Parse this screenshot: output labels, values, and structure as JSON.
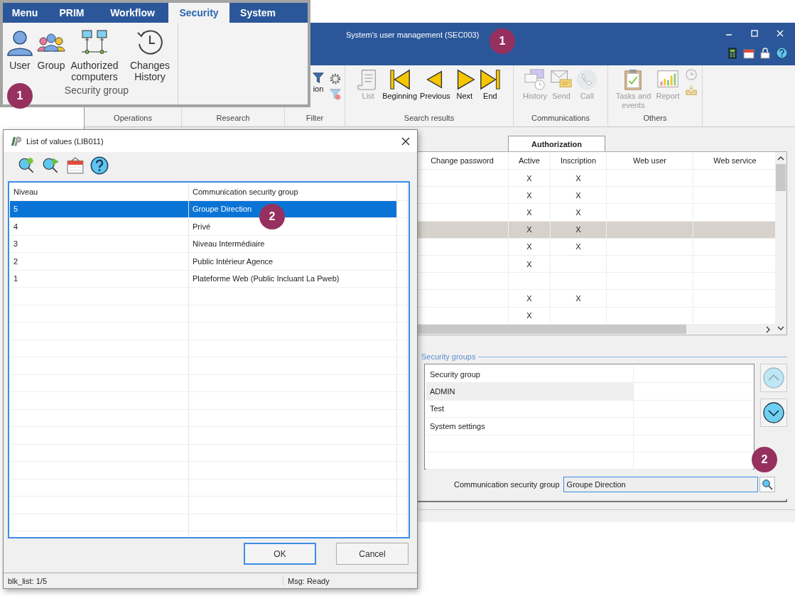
{
  "main_window": {
    "title": "System's user management (SEC003)",
    "ribbon_groups": [
      {
        "label": "Operations"
      },
      {
        "label": "Research"
      },
      {
        "label": "Filter",
        "items": [
          {
            "label": "ion",
            "disabled": false
          }
        ]
      },
      {
        "label": "Search results",
        "items": [
          {
            "label": "List",
            "disabled": true
          },
          {
            "label": "Beginning",
            "disabled": false
          },
          {
            "label": "Previous",
            "disabled": false
          },
          {
            "label": "Next",
            "disabled": false
          },
          {
            "label": "End",
            "disabled": false
          }
        ]
      },
      {
        "label": "Communications",
        "items": [
          {
            "label": "History",
            "disabled": true
          },
          {
            "label": "Send",
            "disabled": true
          },
          {
            "label": "Call",
            "disabled": true
          }
        ]
      },
      {
        "label": "Others",
        "items": [
          {
            "label": "Tasks and events",
            "disabled": true
          },
          {
            "label": "Report",
            "disabled": true
          }
        ]
      }
    ],
    "tab": {
      "label": "Authorization",
      "selected": true
    },
    "table": {
      "columns": [
        "Change password",
        "Active",
        "Inscription",
        "Web user",
        "Web service"
      ],
      "rows": [
        {
          "active": "X",
          "inscription": "X",
          "selected": false
        },
        {
          "active": "X",
          "inscription": "X",
          "selected": false
        },
        {
          "active": "X",
          "inscription": "X",
          "selected": false
        },
        {
          "active": "X",
          "inscription": "X",
          "selected": true
        },
        {
          "active": "X",
          "inscription": "X",
          "selected": false
        },
        {
          "active": "X",
          "selected": false
        },
        {
          "selected": false
        },
        {
          "active": "X",
          "inscription": "X",
          "selected": false
        },
        {
          "active": "X",
          "selected": false
        }
      ]
    },
    "security_groups": {
      "legend": "Security groups",
      "header": "Security group",
      "rows": [
        {
          "name": "ADMIN",
          "selected": true
        },
        {
          "name": "Test",
          "selected": false
        },
        {
          "name": "System settings",
          "selected": false
        }
      ],
      "nav_buttons": [
        {
          "kind": "up",
          "disabled": true
        },
        {
          "kind": "down",
          "disabled": false
        }
      ]
    },
    "communication_field": {
      "label": "Communication security group",
      "value": "Groupe Direction"
    }
  },
  "dialog": {
    "title": "List of values (LIB011)",
    "columns": [
      "Niveau",
      "Communication security group"
    ],
    "rows": [
      {
        "niveau": "5",
        "group": "Groupe Direction",
        "selected": true
      },
      {
        "niveau": "4",
        "group": "Privé",
        "selected": false
      },
      {
        "niveau": "3",
        "group": "Niveau Intermédiaire",
        "selected": false
      },
      {
        "niveau": "2",
        "group": "Public Intérieur Agence",
        "selected": false
      },
      {
        "niveau": "1",
        "group": "Plateforme Web (Public Incluant La Pweb)",
        "selected": false
      }
    ],
    "buttons": [
      {
        "label": "OK",
        "default": true
      },
      {
        "label": "Cancel",
        "default": false
      }
    ],
    "status_bar": {
      "left": "blk_list: 1/5",
      "right": "Msg: Ready"
    }
  },
  "ribbon_overlay": {
    "tabs": [
      {
        "label": "Menu",
        "selected": false
      },
      {
        "label": "PRIM",
        "selected": false
      },
      {
        "label": "Workflow",
        "selected": false
      },
      {
        "label": "Security",
        "selected": true
      },
      {
        "label": "System",
        "selected": false
      }
    ],
    "items": [
      {
        "label": "User"
      },
      {
        "label": "Group"
      },
      {
        "label": "Authorized computers"
      },
      {
        "label": "Changes History"
      }
    ],
    "group_label": "Security group"
  },
  "callouts": [
    {
      "label": "1"
    },
    {
      "label": "1"
    },
    {
      "label": "2"
    },
    {
      "label": "2"
    }
  ]
}
